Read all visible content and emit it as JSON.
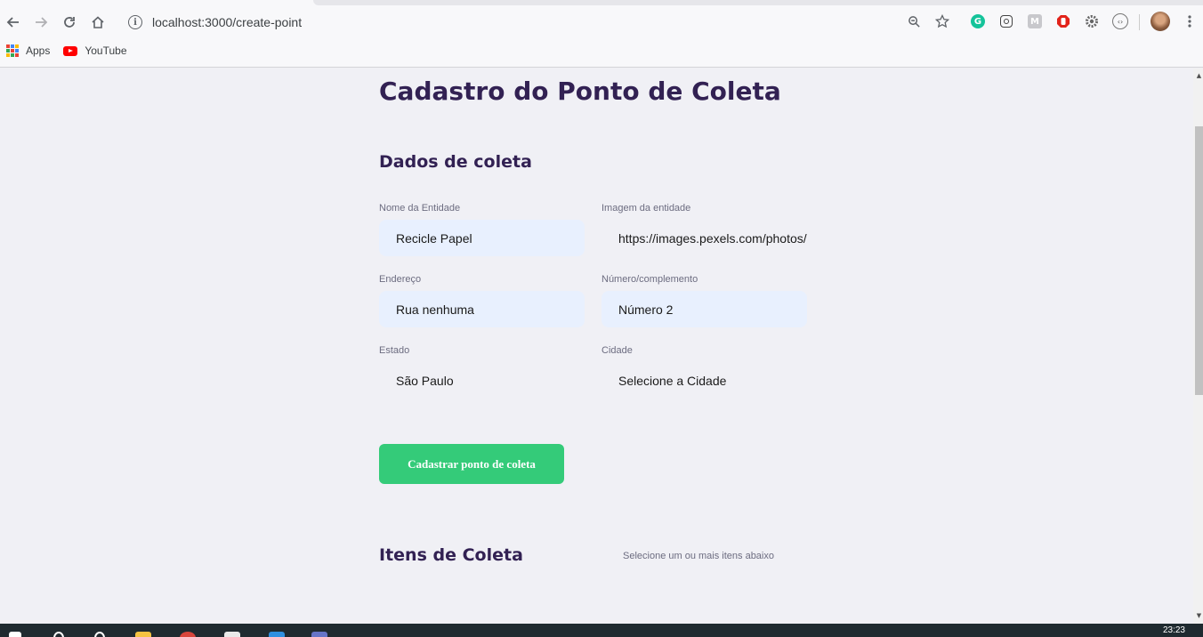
{
  "browser": {
    "url": "localhost:3000/create-point",
    "bookmarks": [
      {
        "label": "Apps",
        "icon": "apps-grid-icon"
      },
      {
        "label": "YouTube",
        "icon": "youtube-icon"
      }
    ]
  },
  "page": {
    "title": "Cadastro do Ponto de Coleta",
    "section_title": "Dados de coleta",
    "fields": [
      {
        "label": "Nome da Entidade",
        "value": "Recicle Papel"
      },
      {
        "label": "Imagem da entidade",
        "value": "https://images.pexels.com/photos/"
      },
      {
        "label": "Endereço",
        "value": "Rua nenhuma"
      },
      {
        "label": "Número/complemento",
        "value": "Número 2"
      },
      {
        "label": "Estado",
        "value": "São Paulo"
      },
      {
        "label": "Cidade",
        "value": "Selecione a Cidade"
      }
    ],
    "submit_label": "Cadastrar ponto de coleta",
    "next_section_title": "Itens de Coleta",
    "next_section_hint": "Selecione um ou mais itens abaixo"
  },
  "taskbar": {
    "clock": "23:23"
  },
  "colors": {
    "title": "#322153",
    "accent": "#34cb79",
    "autofill": "#e8f0fe"
  }
}
